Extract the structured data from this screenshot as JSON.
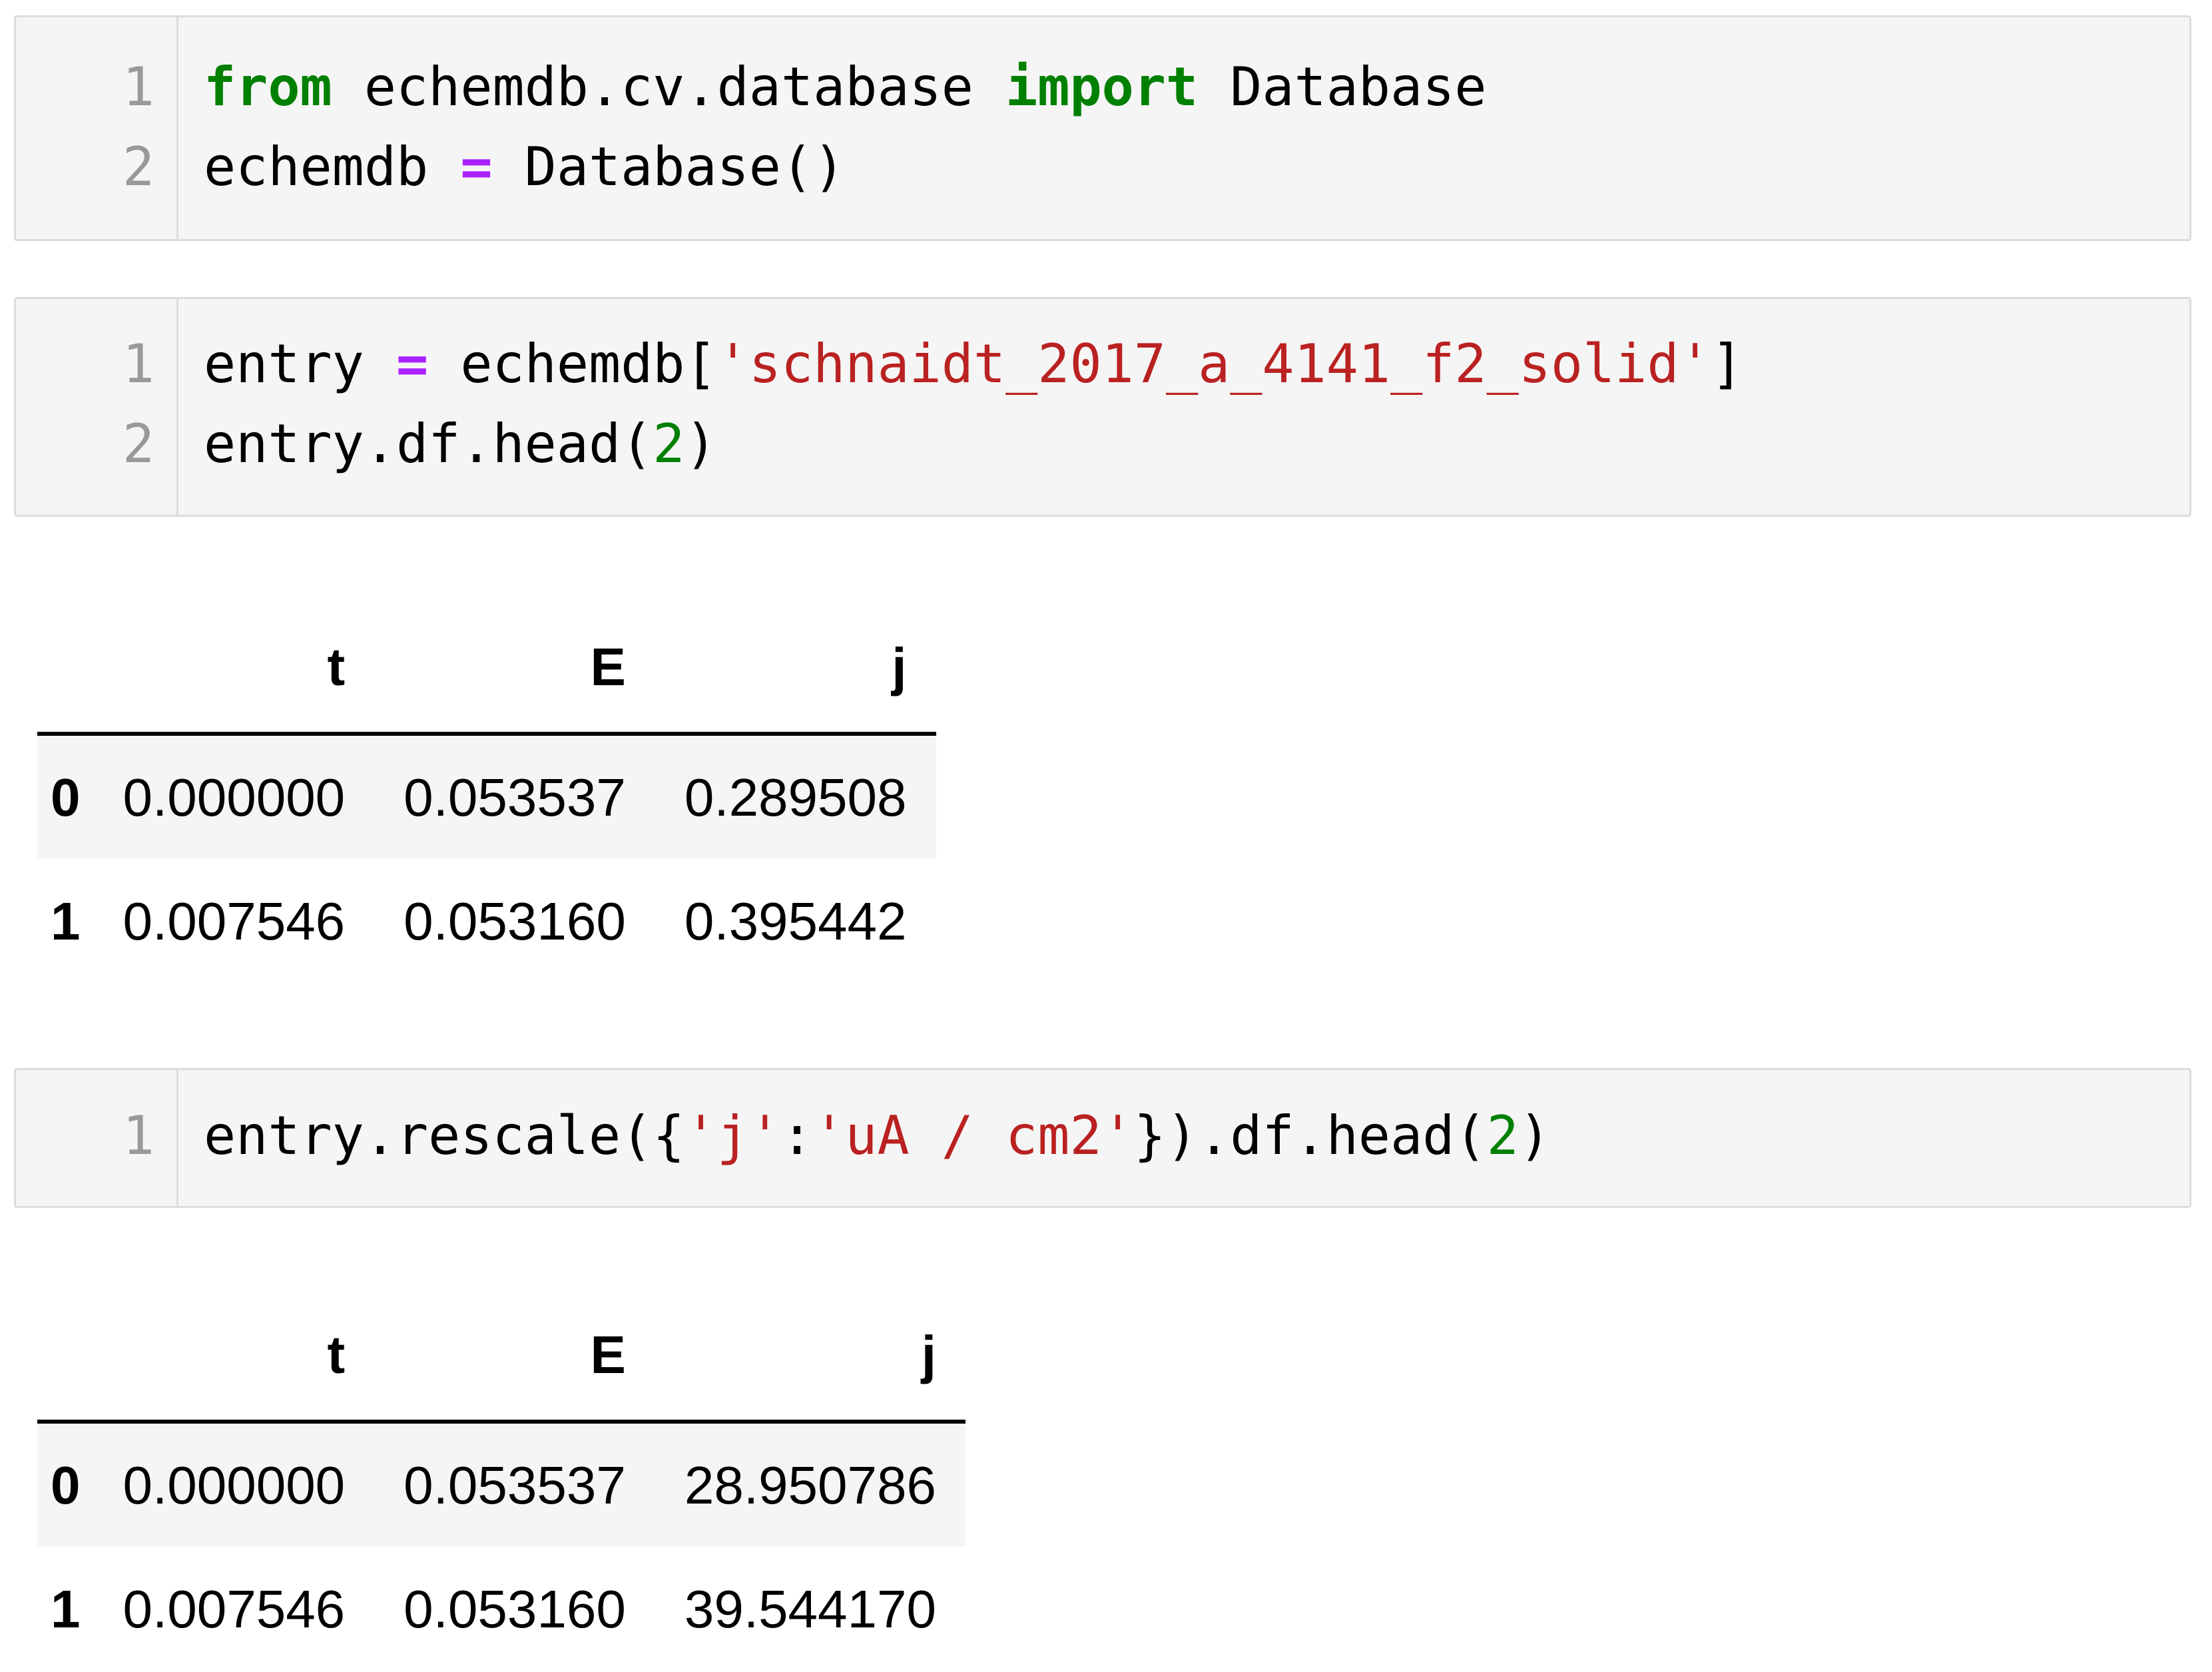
{
  "cells": [
    {
      "lines": [
        {
          "number": "1",
          "tokens": [
            {
              "text": "from",
              "kind": "kw"
            },
            {
              "text": " echemdb.cv.database ",
              "kind": "plain"
            },
            {
              "text": "import",
              "kind": "kw"
            },
            {
              "text": " Database",
              "kind": "plain"
            }
          ]
        },
        {
          "number": "2",
          "tokens": [
            {
              "text": "echemdb ",
              "kind": "plain"
            },
            {
              "text": "=",
              "kind": "op"
            },
            {
              "text": " Database()",
              "kind": "plain"
            }
          ]
        }
      ]
    },
    {
      "lines": [
        {
          "number": "1",
          "tokens": [
            {
              "text": "entry ",
              "kind": "plain"
            },
            {
              "text": "=",
              "kind": "op"
            },
            {
              "text": " echemdb[",
              "kind": "plain"
            },
            {
              "text": "'schnaidt_2017_a_4141_f2_solid'",
              "kind": "str"
            },
            {
              "text": "]",
              "kind": "plain"
            }
          ]
        },
        {
          "number": "2",
          "tokens": [
            {
              "text": "entry.df.head(",
              "kind": "plain"
            },
            {
              "text": "2",
              "kind": "num"
            },
            {
              "text": ")",
              "kind": "plain"
            }
          ]
        }
      ]
    },
    {
      "lines": [
        {
          "number": "1",
          "tokens": [
            {
              "text": "entry.rescale({",
              "kind": "plain"
            },
            {
              "text": "'j'",
              "kind": "str"
            },
            {
              "text": ":",
              "kind": "plain"
            },
            {
              "text": "'uA / cm2'",
              "kind": "str"
            },
            {
              "text": "}).df.head(",
              "kind": "plain"
            },
            {
              "text": "2",
              "kind": "num"
            },
            {
              "text": ")",
              "kind": "plain"
            }
          ]
        }
      ]
    }
  ],
  "outputs": [
    {
      "columns": [
        "t",
        "E",
        "j"
      ],
      "rows": [
        {
          "index": "0",
          "values": [
            "0.000000",
            "0.053537",
            "0.289508"
          ]
        },
        {
          "index": "1",
          "values": [
            "0.007546",
            "0.053160",
            "0.395442"
          ]
        }
      ]
    },
    {
      "columns": [
        "t",
        "E",
        "j"
      ],
      "rows": [
        {
          "index": "0",
          "values": [
            "0.000000",
            "0.053537",
            "28.950786"
          ]
        },
        {
          "index": "1",
          "values": [
            "0.007546",
            "0.053160",
            "39.544170"
          ]
        }
      ]
    }
  ],
  "colors": {
    "keyword": "#008000",
    "operator": "#aa22ff",
    "string": "#ba2121",
    "number": "#008000",
    "line_number": "#999999",
    "cell_background": "#f5f5f5",
    "cell_border": "#dcdcdc"
  }
}
